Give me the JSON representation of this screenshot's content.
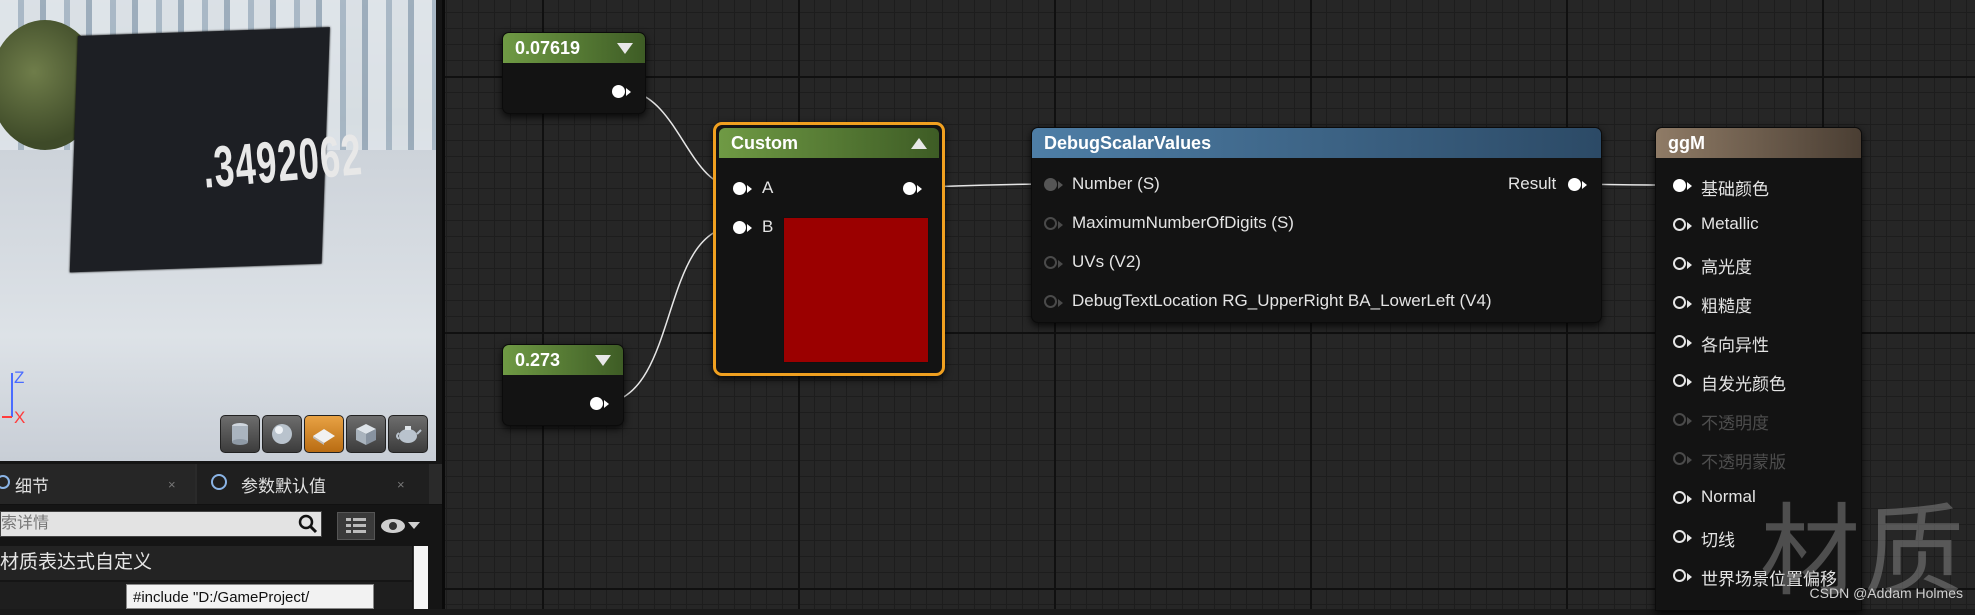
{
  "viewport": {
    "debug_text": ".3492062",
    "axis_z": "Z",
    "axis_x": "X",
    "preview_buttons": [
      "cylinder-icon",
      "sphere-icon",
      "plane-icon",
      "cube-icon",
      "teapot-icon"
    ],
    "active_preview": "plane-icon"
  },
  "panel_tabs": [
    {
      "label": "细节",
      "close": "×"
    },
    {
      "label": "参数默认值",
      "close": "×"
    }
  ],
  "search": {
    "placeholder": "索详情"
  },
  "details": {
    "section_title": "材质表达式自定义",
    "code_value": "#include \"D:/GameProject/"
  },
  "nodes": {
    "const1": {
      "value": "0.07619"
    },
    "const2": {
      "value": "0.273"
    },
    "custom": {
      "title": "Custom",
      "inputs": [
        "A",
        "B"
      ],
      "swatch_color": "#9b0000"
    },
    "debug": {
      "title": "DebugScalarValues",
      "inputs": [
        "Number (S)",
        "MaximumNumberOfDigits (S)",
        "UVs (V2)",
        "DebugTextLocation RG_UpperRight BA_LowerLeft (V4)"
      ],
      "output": "Result"
    },
    "material": {
      "title": "ggM",
      "inputs": [
        {
          "label": "基础颜色",
          "state": "connected"
        },
        {
          "label": "Metallic",
          "state": "enabled"
        },
        {
          "label": "高光度",
          "state": "enabled"
        },
        {
          "label": "粗糙度",
          "state": "enabled"
        },
        {
          "label": "各向异性",
          "state": "enabled"
        },
        {
          "label": "自发光颜色",
          "state": "enabled"
        },
        {
          "label": "不透明度",
          "state": "disabled"
        },
        {
          "label": "不透明蒙版",
          "state": "disabled"
        },
        {
          "label": "Normal",
          "state": "enabled"
        },
        {
          "label": "切线",
          "state": "enabled"
        },
        {
          "label": "世界场景位置偏移",
          "state": "enabled"
        }
      ]
    }
  },
  "watermark": "材质",
  "credit": "CSDN @Addam Holmes",
  "colors": {
    "selection": "#f0a020",
    "constant_header": "#5f8a39",
    "function_header": "#3f6a8e",
    "material_header": "#7a6654"
  }
}
